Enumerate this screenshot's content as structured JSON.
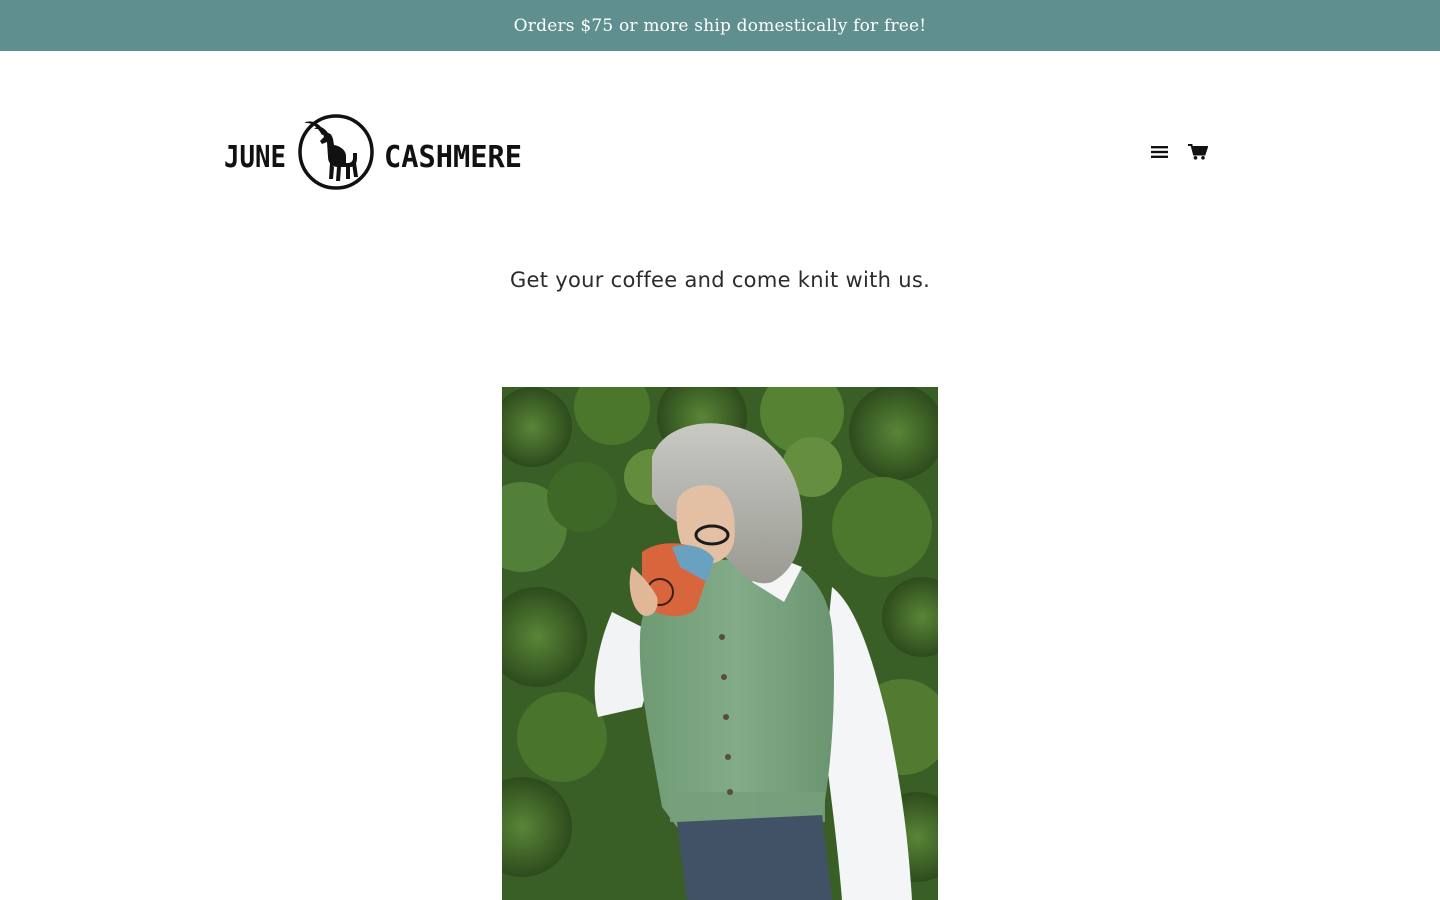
{
  "announcement": {
    "text": "Orders $75 or more ship domestically for free!",
    "background_color": "#5f8f8f"
  },
  "header": {
    "logo": {
      "brand_left": "JUNE",
      "brand_right": "CASHMERE",
      "alt": "June Cashmere"
    },
    "icons": {
      "menu": "hamburger-menu-icon",
      "cart": "shopping-cart-icon"
    }
  },
  "main": {
    "tagline": "Get your coffee and come knit with us.",
    "hero_image_alt": "Woman with gray hair drinking from a mug, wearing a green knit sweater vest over a white shirt in front of a hedge"
  },
  "colors": {
    "accent": "#5f8f8f",
    "text": "#222222",
    "background": "#ffffff"
  }
}
